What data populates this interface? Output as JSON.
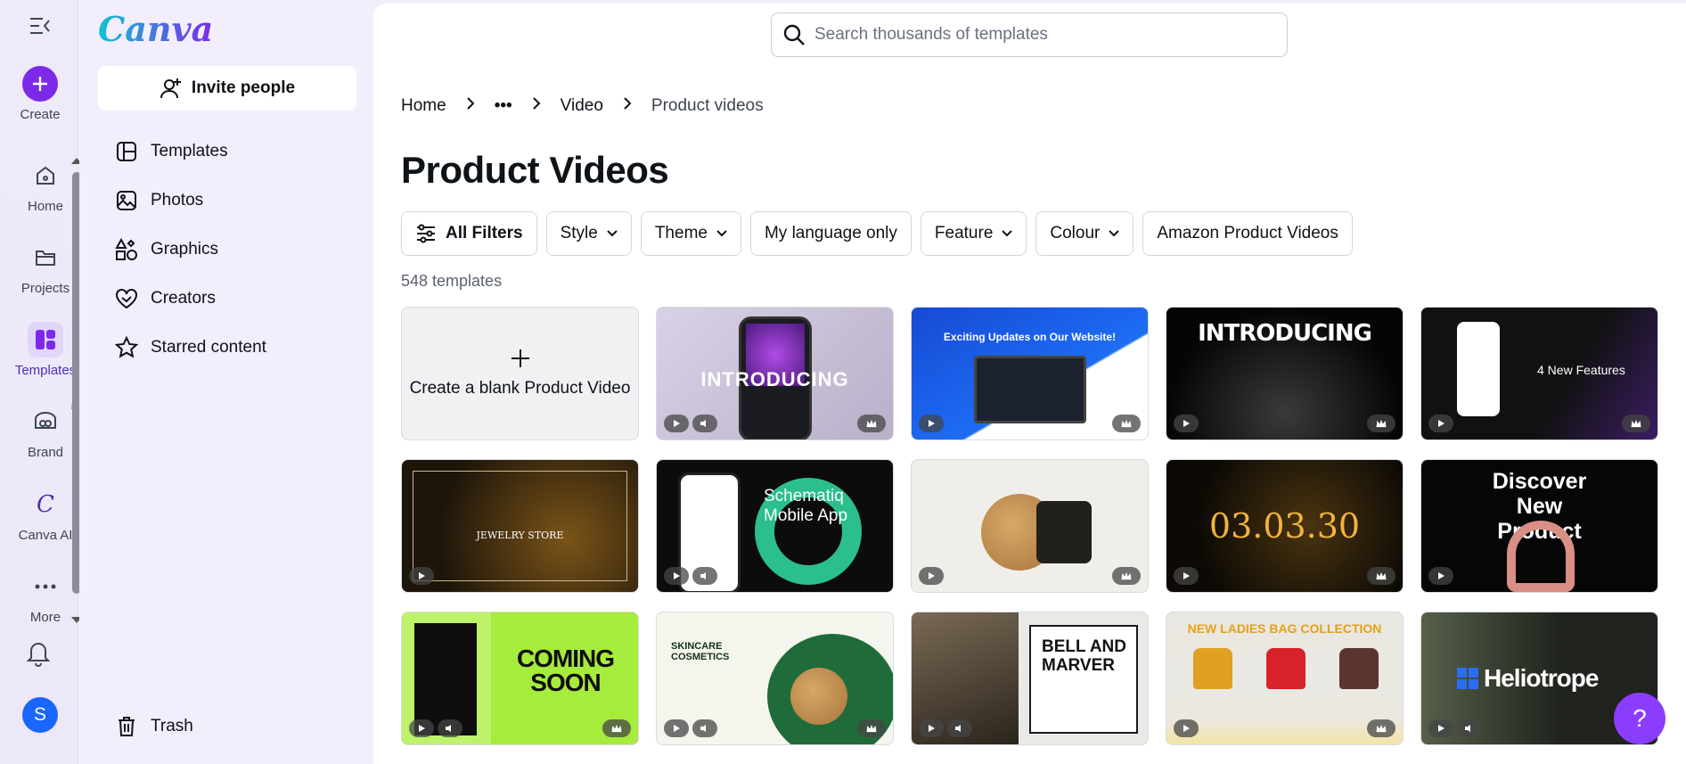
{
  "rail": {
    "create_label": "Create",
    "items": [
      {
        "label": "Home",
        "icon": "home-icon"
      },
      {
        "label": "Projects",
        "icon": "folder-icon"
      },
      {
        "label": "Templates",
        "icon": "templates-icon"
      },
      {
        "label": "Brand",
        "icon": "brand-icon"
      },
      {
        "label": "Canva AI",
        "icon": "canva-ai-icon"
      },
      {
        "label": "More",
        "icon": "more-icon"
      }
    ],
    "avatar_initial": "S"
  },
  "panel": {
    "logo": "Canva",
    "invite_label": "Invite people",
    "nav": [
      {
        "label": "Templates",
        "icon": "templates-icon"
      },
      {
        "label": "Photos",
        "icon": "photos-icon"
      },
      {
        "label": "Graphics",
        "icon": "graphics-icon"
      },
      {
        "label": "Creators",
        "icon": "creators-icon"
      },
      {
        "label": "Starred content",
        "icon": "star-icon"
      }
    ],
    "trash_label": "Trash"
  },
  "search": {
    "placeholder": "Search thousands of templates"
  },
  "breadcrumb": [
    "Home",
    "•••",
    "Video",
    "Product videos"
  ],
  "page_title": "Product Videos",
  "filters": [
    "All Filters",
    "Style",
    "Theme",
    "My language only",
    "Feature",
    "Colour",
    "Amazon Product Videos"
  ],
  "template_count": "548 templates",
  "blank_card_label": "Create a blank Product Video",
  "cards": [
    {
      "text": "INTRODUCING"
    },
    {
      "text": "Exciting Updates on Our Website!"
    },
    {
      "text": "INTRODUCING"
    },
    {
      "text": "4 New Features"
    },
    {
      "text": "JEWELRY STORE"
    },
    {
      "text": "Schematiq Mobile App"
    },
    {
      "text": ""
    },
    {
      "text": "03.03.30"
    },
    {
      "text": "Discover New Product"
    },
    {
      "text": "COMING SOON"
    },
    {
      "text": "SKINCARE COSMETICS"
    },
    {
      "text": "BELL AND MARVER"
    },
    {
      "text": "NEW LADIES BAG COLLECTION"
    },
    {
      "text": "Heliotrope"
    }
  ],
  "help_label": "?",
  "colors": {
    "accent": "#7d2ae8",
    "help": "#8b3dff"
  }
}
